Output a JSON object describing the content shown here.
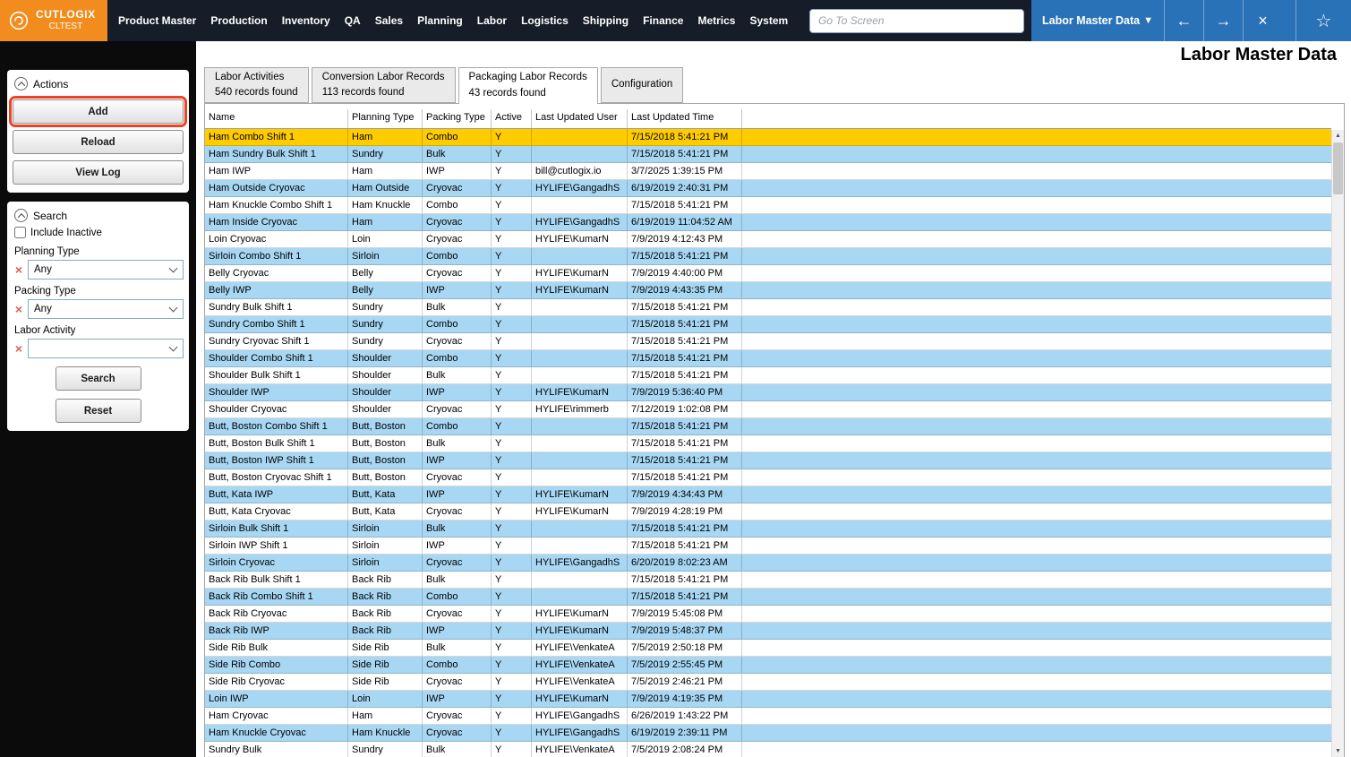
{
  "app": {
    "logo_title": "CUTLOGIX",
    "logo_subtitle": "CLTEST",
    "menu_items": [
      "Product Master",
      "Production",
      "Inventory",
      "QA",
      "Sales",
      "Planning",
      "Labor",
      "Logistics",
      "Shipping",
      "Finance",
      "Metrics",
      "System"
    ],
    "goto_placeholder": "Go To Screen",
    "screen_selector": "Labor Master Data"
  },
  "page": {
    "title": "Labor Master Data"
  },
  "actions_panel": {
    "title": "Actions",
    "buttons": [
      "Add",
      "Reload",
      "View Log"
    ]
  },
  "search_panel": {
    "title": "Search",
    "include_inactive_label": "Include Inactive",
    "fields": [
      {
        "label": "Planning Type",
        "value": "Any"
      },
      {
        "label": "Packing Type",
        "value": "Any"
      },
      {
        "label": "Labor Activity",
        "value": ""
      }
    ],
    "search_label": "Search",
    "reset_label": "Reset"
  },
  "tabs": [
    {
      "label": "Labor Activities",
      "sub": "540 records found",
      "active": false
    },
    {
      "label": "Conversion Labor Records",
      "sub": "113 records found",
      "active": false
    },
    {
      "label": "Packaging Labor Records",
      "sub": "43 records found",
      "active": true
    },
    {
      "label": "Configuration",
      "sub": "",
      "active": false
    }
  ],
  "table": {
    "columns": [
      "Name",
      "Planning Type",
      "Packing Type",
      "Active",
      "Last Updated User",
      "Last Updated Time"
    ],
    "rows": [
      [
        "Ham Combo Shift 1",
        "Ham",
        "Combo",
        "Y",
        "",
        "7/15/2018 5:41:21 PM"
      ],
      [
        "Ham Sundry Bulk Shift 1",
        "Sundry",
        "Bulk",
        "Y",
        "",
        "7/15/2018 5:41:21 PM"
      ],
      [
        "Ham IWP",
        "Ham",
        "IWP",
        "Y",
        "bill@cutlogix.io",
        "3/7/2025 1:39:15 PM"
      ],
      [
        "Ham Outside Cryovac",
        "Ham Outside",
        "Cryovac",
        "Y",
        "HYLIFE\\GangadhS",
        "6/19/2019 2:40:31 PM"
      ],
      [
        "Ham Knuckle Combo Shift 1",
        "Ham Knuckle",
        "Combo",
        "Y",
        "",
        "7/15/2018 5:41:21 PM"
      ],
      [
        "Ham Inside Cryovac",
        "Ham",
        "Cryovac",
        "Y",
        "HYLIFE\\GangadhS",
        "6/19/2019 11:04:52 AM"
      ],
      [
        "Loin Cryovac",
        "Loin",
        "Cryovac",
        "Y",
        "HYLIFE\\KumarN",
        "7/9/2019 4:12:43 PM"
      ],
      [
        "Sirloin Combo Shift 1",
        "Sirloin",
        "Combo",
        "Y",
        "",
        "7/15/2018 5:41:21 PM"
      ],
      [
        "Belly Cryovac",
        "Belly",
        "Cryovac",
        "Y",
        "HYLIFE\\KumarN",
        "7/9/2019 4:40:00 PM"
      ],
      [
        "Belly IWP",
        "Belly",
        "IWP",
        "Y",
        "HYLIFE\\KumarN",
        "7/9/2019 4:43:35 PM"
      ],
      [
        "Sundry Bulk Shift 1",
        "Sundry",
        "Bulk",
        "Y",
        "",
        "7/15/2018 5:41:21 PM"
      ],
      [
        "Sundry Combo Shift 1",
        "Sundry",
        "Combo",
        "Y",
        "",
        "7/15/2018 5:41:21 PM"
      ],
      [
        "Sundry Cryovac Shift 1",
        "Sundry",
        "Cryovac",
        "Y",
        "",
        "7/15/2018 5:41:21 PM"
      ],
      [
        "Shoulder Combo Shift 1",
        "Shoulder",
        "Combo",
        "Y",
        "",
        "7/15/2018 5:41:21 PM"
      ],
      [
        "Shoulder Bulk Shift 1",
        "Shoulder",
        "Bulk",
        "Y",
        "",
        "7/15/2018 5:41:21 PM"
      ],
      [
        "Shoulder IWP",
        "Shoulder",
        "IWP",
        "Y",
        "HYLIFE\\KumarN",
        "7/9/2019 5:36:40 PM"
      ],
      [
        "Shoulder Cryovac",
        "Shoulder",
        "Cryovac",
        "Y",
        "HYLIFE\\rimmerb",
        "7/12/2019 1:02:08 PM"
      ],
      [
        "Butt, Boston Combo Shift 1",
        "Butt, Boston",
        "Combo",
        "Y",
        "",
        "7/15/2018 5:41:21 PM"
      ],
      [
        "Butt, Boston Bulk Shift 1",
        "Butt, Boston",
        "Bulk",
        "Y",
        "",
        "7/15/2018 5:41:21 PM"
      ],
      [
        "Butt, Boston IWP Shift 1",
        "Butt, Boston",
        "IWP",
        "Y",
        "",
        "7/15/2018 5:41:21 PM"
      ],
      [
        "Butt, Boston Cryovac Shift 1",
        "Butt, Boston",
        "Cryovac",
        "Y",
        "",
        "7/15/2018 5:41:21 PM"
      ],
      [
        "Butt, Kata IWP",
        "Butt, Kata",
        "IWP",
        "Y",
        "HYLIFE\\KumarN",
        "7/9/2019 4:34:43 PM"
      ],
      [
        "Butt, Kata Cryovac",
        "Butt, Kata",
        "Cryovac",
        "Y",
        "HYLIFE\\KumarN",
        "7/9/2019 4:28:19 PM"
      ],
      [
        "Sirloin Bulk Shift 1",
        "Sirloin",
        "Bulk",
        "Y",
        "",
        "7/15/2018 5:41:21 PM"
      ],
      [
        "Sirloin IWP Shift 1",
        "Sirloin",
        "IWP",
        "Y",
        "",
        "7/15/2018 5:41:21 PM"
      ],
      [
        "Sirloin Cryovac",
        "Sirloin",
        "Cryovac",
        "Y",
        "HYLIFE\\GangadhS",
        "6/20/2019 8:02:23 AM"
      ],
      [
        "Back Rib Bulk Shift 1",
        "Back Rib",
        "Bulk",
        "Y",
        "",
        "7/15/2018 5:41:21 PM"
      ],
      [
        "Back Rib Combo Shift 1",
        "Back Rib",
        "Combo",
        "Y",
        "",
        "7/15/2018 5:41:21 PM"
      ],
      [
        "Back Rib Cryovac",
        "Back Rib",
        "Cryovac",
        "Y",
        "HYLIFE\\KumarN",
        "7/9/2019 5:45:08 PM"
      ],
      [
        "Back Rib IWP",
        "Back Rib",
        "IWP",
        "Y",
        "HYLIFE\\KumarN",
        "7/9/2019 5:48:37 PM"
      ],
      [
        "Side Rib Bulk",
        "Side Rib",
        "Bulk",
        "Y",
        "HYLIFE\\VenkateA",
        "7/5/2019 2:50:18 PM"
      ],
      [
        "Side Rib Combo",
        "Side Rib",
        "Combo",
        "Y",
        "HYLIFE\\VenkateA",
        "7/5/2019 2:55:45 PM"
      ],
      [
        "Side Rib Cryovac",
        "Side Rib",
        "Cryovac",
        "Y",
        "HYLIFE\\VenkateA",
        "7/5/2019 2:46:21 PM"
      ],
      [
        "Loin IWP",
        "Loin",
        "IWP",
        "Y",
        "HYLIFE\\KumarN",
        "7/9/2019 4:19:35 PM"
      ],
      [
        "Ham Cryovac",
        "Ham",
        "Cryovac",
        "Y",
        "HYLIFE\\GangadhS",
        "6/26/2019 1:43:22 PM"
      ],
      [
        "Ham Knuckle Cryovac",
        "Ham Knuckle",
        "Cryovac",
        "Y",
        "HYLIFE\\GangadhS",
        "6/19/2019 2:39:11 PM"
      ],
      [
        "Sundry Bulk",
        "Sundry",
        "Bulk",
        "Y",
        "HYLIFE\\VenkateA",
        "7/5/2019 2:08:24 PM"
      ]
    ]
  },
  "icons": {
    "back_arrow": "←",
    "forward_arrow": "→",
    "close": "×",
    "star": "☆",
    "caret_down": "▼",
    "clear_filter": "×",
    "scroll_up": "▲",
    "scroll_down": "▼"
  },
  "colors": {
    "brand_orange": "#F28C1E",
    "topbar_bg": "#161C28",
    "nav_blue": "#2A72B8",
    "selected_row": "#FFCC00",
    "alt_row": "#A8D7F3",
    "highlight_border": "#EF4123",
    "clear_icon_red": "#E05C5C"
  }
}
